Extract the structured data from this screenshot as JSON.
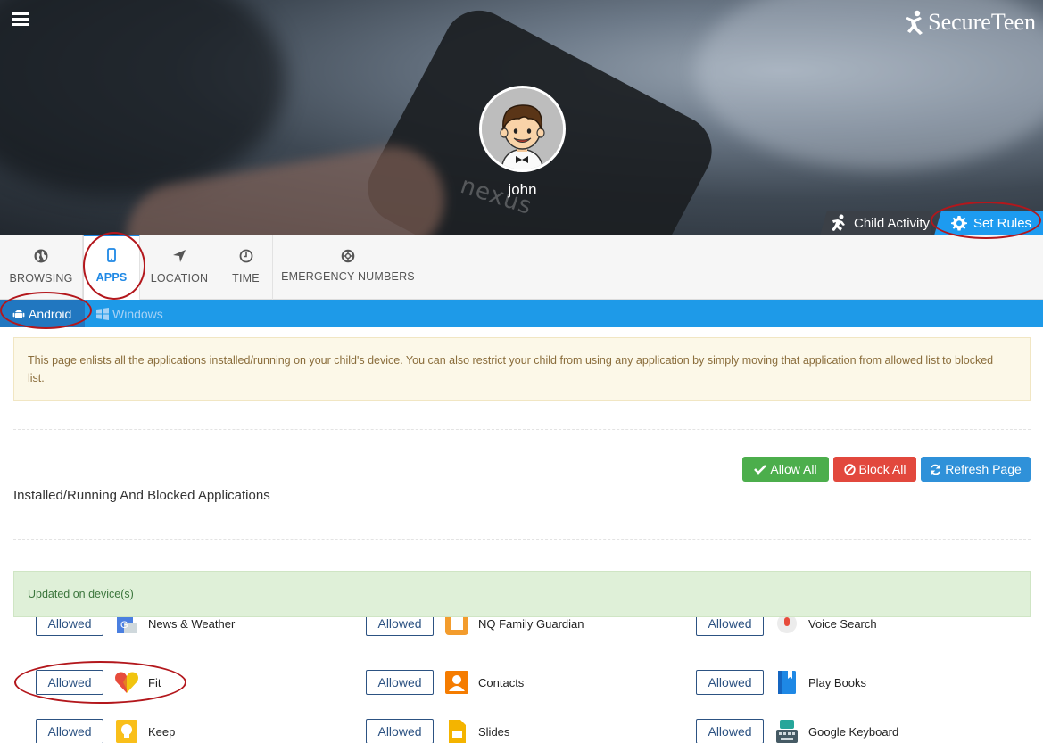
{
  "brand": {
    "name": "SecureTeen"
  },
  "profile": {
    "name": "john"
  },
  "hero_tabs": {
    "child_activity": "Child Activity",
    "set_rules": "Set Rules"
  },
  "tabs": [
    {
      "label": "BROWSING",
      "icon": "globe-icon"
    },
    {
      "label": "APPS",
      "icon": "mobile-icon",
      "active": true
    },
    {
      "label": "LOCATION",
      "icon": "location-arrow-icon"
    },
    {
      "label": "TIME",
      "icon": "clock-icon"
    },
    {
      "label": "EMERGENCY NUMBERS",
      "icon": "life-ring-icon"
    }
  ],
  "os_tabs": {
    "android": "Android",
    "windows": "Windows"
  },
  "info_text": "This page enlists all the applications installed/running on your child's device. You can also restrict your child from using any application by simply moving that application from allowed list to blocked list.",
  "section_title": "Installed/Running And Blocked Applications",
  "actions": {
    "allow_all": "Allow All",
    "block_all": "Block All",
    "refresh": "Refresh Page"
  },
  "success_text": "Updated on device(s)",
  "apps": [
    {
      "status": "Allowed",
      "name": "News & Weather",
      "icon": "news-weather-icon"
    },
    {
      "status": "Allowed",
      "name": "NQ Family Guardian",
      "icon": "nq-family-guardian-icon"
    },
    {
      "status": "Allowed",
      "name": "Voice Search",
      "icon": "voice-search-icon"
    },
    {
      "status": "Allowed",
      "name": "Fit",
      "icon": "fit-heart-icon"
    },
    {
      "status": "Allowed",
      "name": "Contacts",
      "icon": "contacts-icon"
    },
    {
      "status": "Allowed",
      "name": "Play Books",
      "icon": "play-books-icon"
    },
    {
      "status": "Allowed",
      "name": "Keep",
      "icon": "keep-bulb-icon"
    },
    {
      "status": "Allowed",
      "name": "Slides",
      "icon": "slides-icon"
    },
    {
      "status": "Allowed",
      "name": "Google Keyboard",
      "icon": "keyboard-icon"
    }
  ],
  "colors": {
    "primary_blue": "#1e9ae8",
    "allow_green": "#4cae4c",
    "block_red": "#e2483d",
    "refresh_blue": "#2f91d9",
    "annotation_red": "#b3171c"
  }
}
